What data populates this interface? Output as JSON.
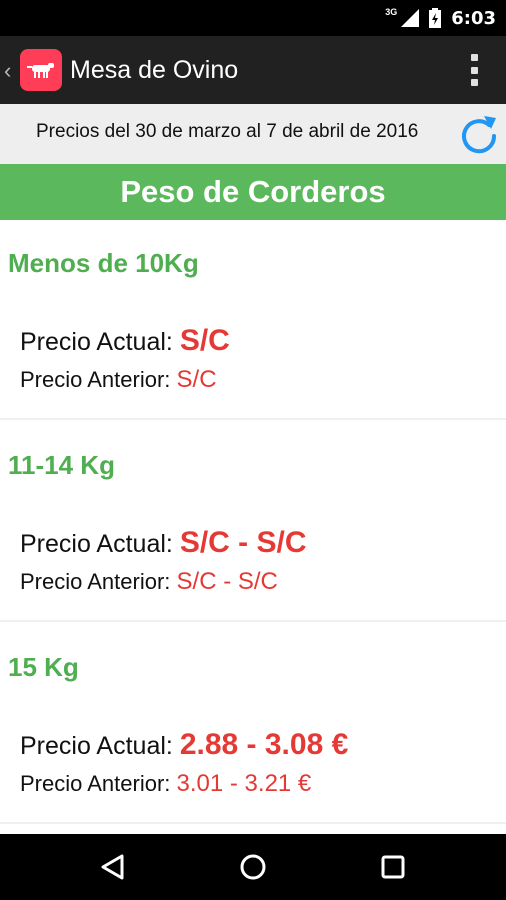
{
  "status": {
    "network": "3G",
    "time": "6:03"
  },
  "appbar": {
    "back_glyph": "‹",
    "title": "Mesa de Ovino"
  },
  "date_bar": {
    "text": "Precios del 30 de marzo al 7 de abril de 2016"
  },
  "section": {
    "title": "Peso de Corderos"
  },
  "labels": {
    "actual": "Precio Actual: ",
    "anterior": "Precio Anterior: "
  },
  "categories": [
    {
      "name": "Menos de 10Kg",
      "actual": "S/C",
      "anterior": "S/C"
    },
    {
      "name": "11-14 Kg",
      "actual": "S/C - S/C",
      "anterior": "S/C - S/C"
    },
    {
      "name": "15 Kg",
      "actual": "2.88 - 3.08 €",
      "anterior": "3.01 - 3.21 €"
    }
  ],
  "colors": {
    "green": "#5cb85c",
    "red": "#e53935",
    "appbar": "#212121",
    "refresh": "#2196f3"
  }
}
